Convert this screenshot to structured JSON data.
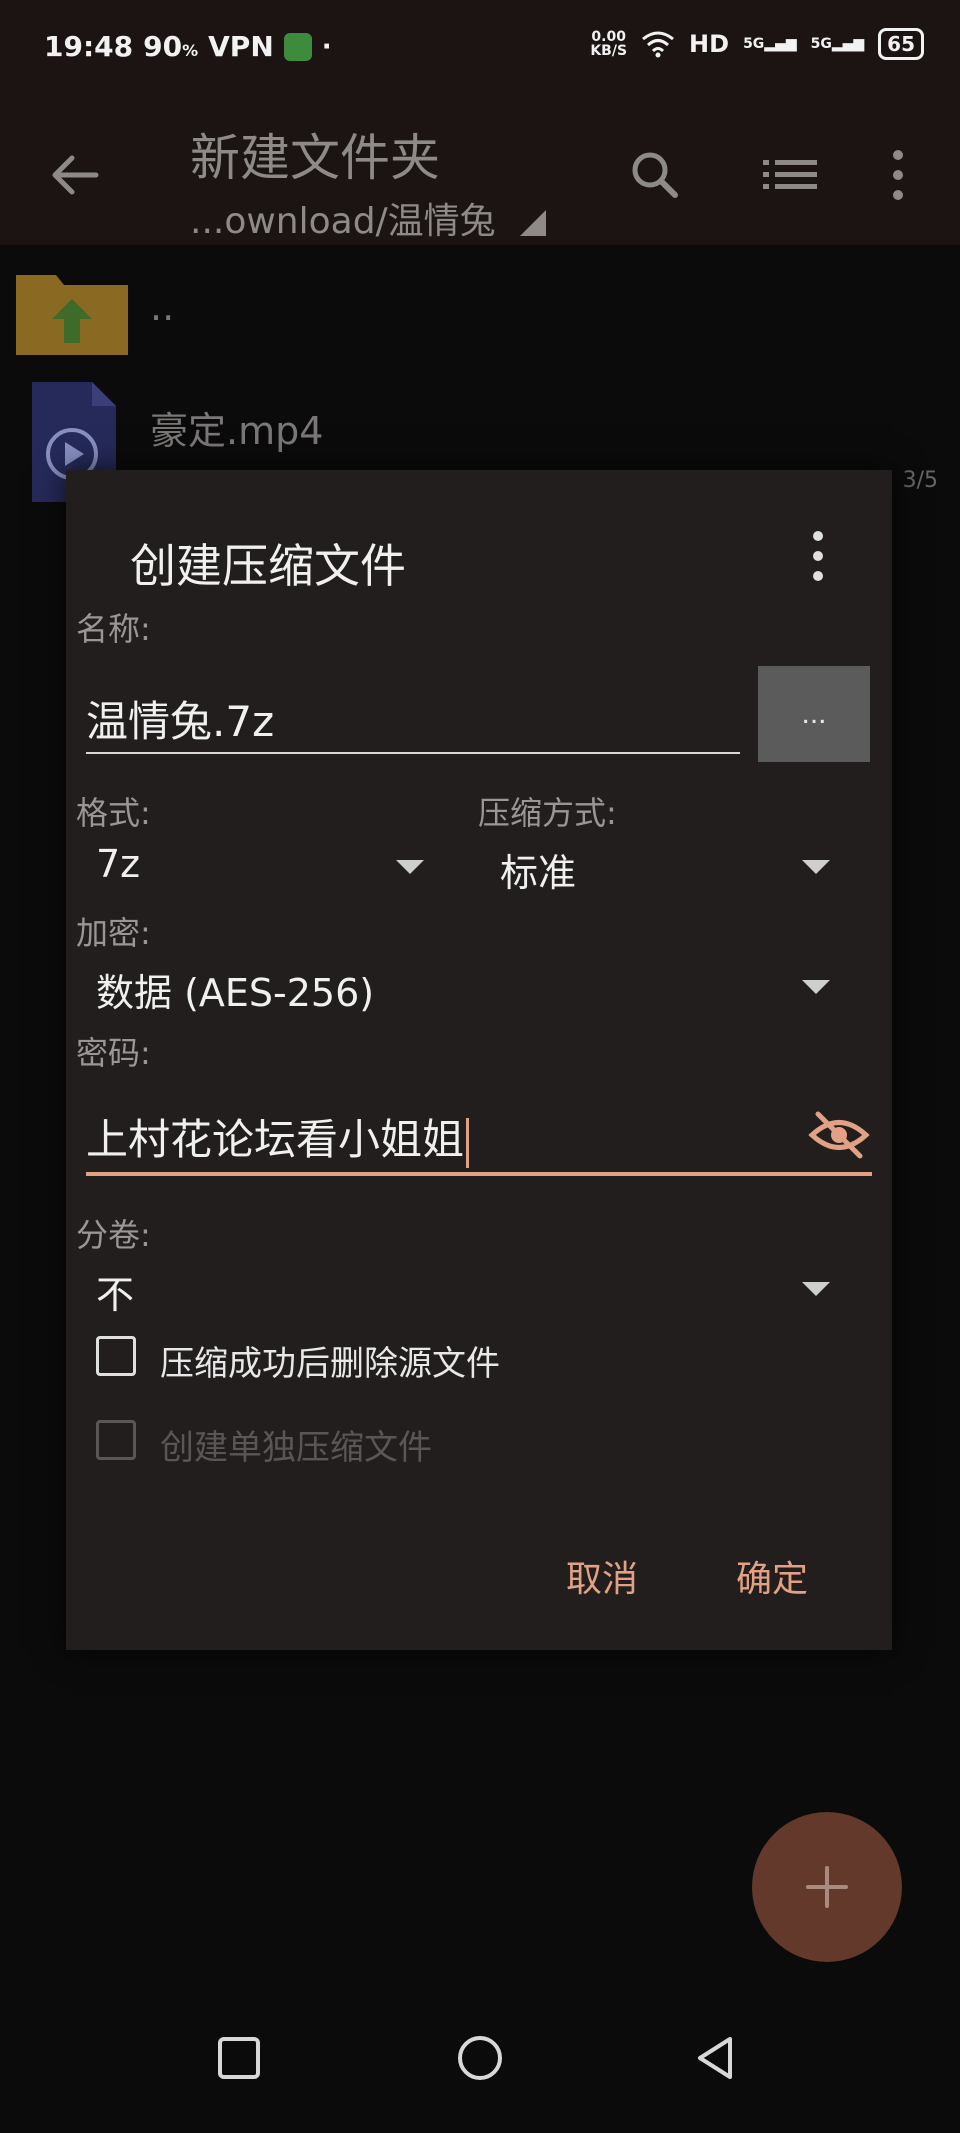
{
  "status_bar": {
    "time": "19:48",
    "net": "90",
    "net_unit": "%",
    "vpn": "VPN",
    "dot": "·",
    "speed_top": "0.00",
    "speed_bottom": "KB/S",
    "hd": "HD",
    "signal1": "5G",
    "signal2": "5G",
    "battery": "65"
  },
  "toolbar": {
    "title": "新建文件夹",
    "path": "...ownload/温情兔"
  },
  "files": [
    {
      "name": ".."
    },
    {
      "name": "豪定.mp4",
      "meta": "3/5"
    }
  ],
  "dialog": {
    "title": "创建压缩文件",
    "name_label": "名称:",
    "name_value": "温情兔.7z",
    "more_button": "...",
    "format_label": "格式:",
    "format_value": "7z",
    "method_label": "压缩方式:",
    "method_value": "标准",
    "encrypt_label": "加密:",
    "encrypt_value": "数据 (AES-256)",
    "password_label": "密码:",
    "password_value": "上村花论坛看小姐姐",
    "split_label": "分卷:",
    "split_value": "不",
    "delete_after": "压缩成功后删除源文件",
    "separate": "创建单独压缩文件",
    "cancel": "取消",
    "confirm": "确定"
  },
  "colors": {
    "accent": "#e2a185",
    "dialog_bg": "#221e1d",
    "toolbar_bg": "#1b1412",
    "fab": "#62392b"
  }
}
